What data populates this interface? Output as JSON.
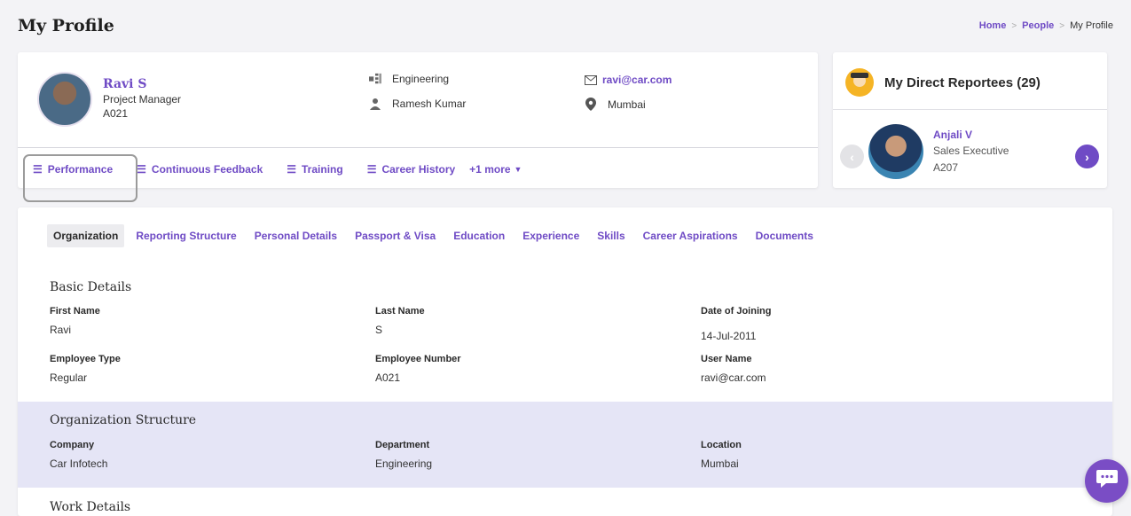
{
  "page": {
    "title": "My Profile"
  },
  "breadcrumb": {
    "home": "Home",
    "people": "People",
    "current": "My Profile",
    "separator": ">"
  },
  "profile": {
    "name": "Ravi S",
    "role": "Project Manager",
    "id": "A021",
    "department": "Engineering",
    "manager": "Ramesh Kumar",
    "email": "ravi@car.com",
    "location": "Mumbai",
    "tabs": [
      {
        "label": "Performance"
      },
      {
        "label": "Continuous Feedback"
      },
      {
        "label": "Training"
      },
      {
        "label": "Career History"
      }
    ],
    "more_label": "+1 more"
  },
  "reportees": {
    "title": "My Direct Reportees (29)",
    "current": {
      "name": "Anjali V",
      "role": "Sales Executive",
      "id": "A207"
    }
  },
  "main": {
    "tabs": [
      {
        "label": "Organization"
      },
      {
        "label": "Reporting Structure"
      },
      {
        "label": "Personal Details"
      },
      {
        "label": "Passport & Visa"
      },
      {
        "label": "Education"
      },
      {
        "label": "Experience"
      },
      {
        "label": "Skills"
      },
      {
        "label": "Career Aspirations"
      },
      {
        "label": "Documents"
      }
    ],
    "basic": {
      "title": "Basic Details",
      "first_name_label": "First Name",
      "first_name": "Ravi",
      "last_name_label": "Last Name",
      "last_name": "S",
      "doj_label": "Date of Joining",
      "doj": "14-Jul-2011",
      "emp_type_label": "Employee Type",
      "emp_type": "Regular",
      "emp_no_label": "Employee Number",
      "emp_no": "A021",
      "username_label": "User Name",
      "username": "ravi@car.com"
    },
    "org": {
      "title": "Organization Structure",
      "company_label": "Company",
      "company": "Car Infotech",
      "dept_label": "Department",
      "dept": "Engineering",
      "location_label": "Location",
      "location": "Mumbai"
    },
    "work": {
      "title": "Work Details"
    }
  },
  "colors": {
    "accent": "#6f4bc5",
    "org_bg": "#e5e5f6",
    "fab": "#7a4dc5"
  }
}
